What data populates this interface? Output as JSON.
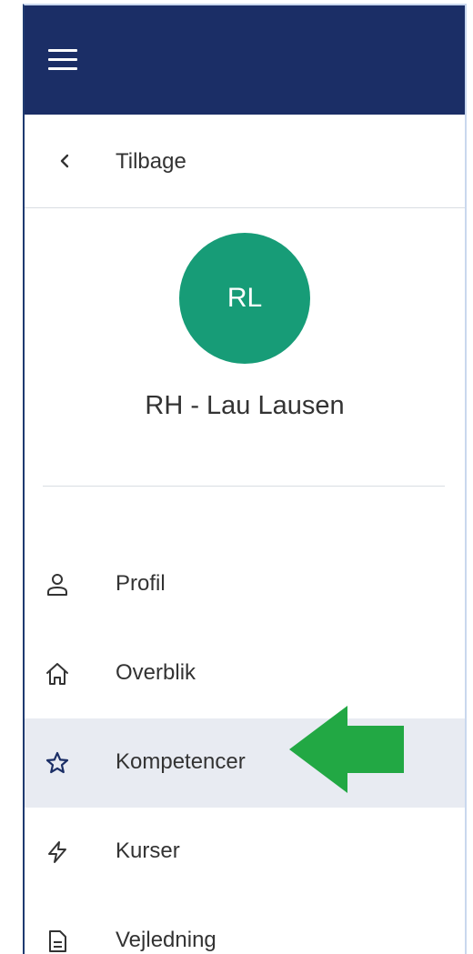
{
  "header": {
    "menu_icon": "hamburger-icon",
    "background_color": "#1b2e66"
  },
  "back": {
    "icon": "chevron-left-icon",
    "label": "Tilbage"
  },
  "user": {
    "initials": "RL",
    "name": "RH - Lau Lausen",
    "avatar_color": "#179c77"
  },
  "nav": {
    "active_index": 2,
    "items": [
      {
        "label": "Profil",
        "icon": "person-icon"
      },
      {
        "label": "Overblik",
        "icon": "home-icon"
      },
      {
        "label": "Kompetencer",
        "icon": "star-icon"
      },
      {
        "label": "Kurser",
        "icon": "lightning-icon"
      },
      {
        "label": "Vejledning",
        "icon": "document-icon"
      }
    ]
  },
  "annotation": {
    "icon": "green-arrow-icon",
    "color": "#22a844"
  }
}
